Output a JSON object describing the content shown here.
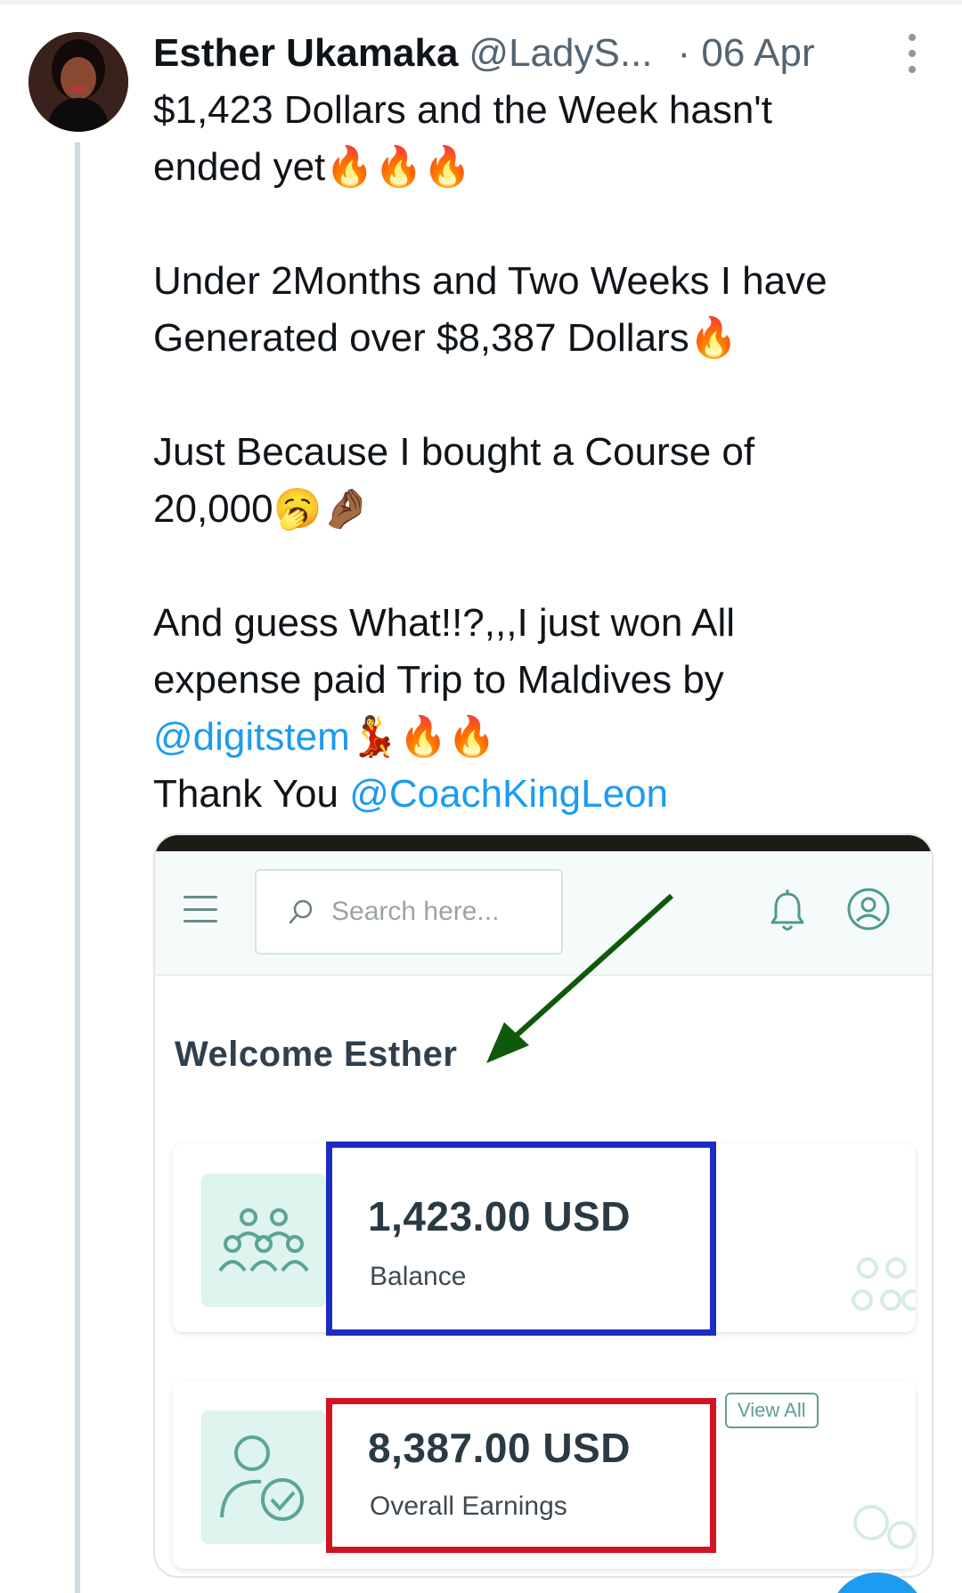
{
  "tweet": {
    "author_name": "Esther Ukamaka",
    "handle": "@LadyS...",
    "date": "· 06 Apr",
    "paragraphs": [
      {
        "lines": [
          "$1,423 Dollars and the Week hasn't",
          "ended yet🔥🔥🔥"
        ]
      },
      {
        "lines": [
          "Under 2Months and Two Weeks I have",
          "Generated over $8,387 Dollars🔥"
        ]
      },
      {
        "lines": [
          "Just Because I bought a Course of",
          "20,000🥱🤌🏾"
        ]
      }
    ],
    "last_paragraph": {
      "line1": "And guess What!!?,,,I just won All",
      "line2": "expense paid  Trip to Maldives by",
      "mention1": "@digitstem",
      "mention1_suffix": "💃🔥🔥",
      "line4_prefix": "Thank You ",
      "mention2": "@CoachKingLeon"
    }
  },
  "embedded_app": {
    "search_placeholder": "Search here...",
    "welcome": "Welcome Esther",
    "balance_amount": "1,423.00 USD",
    "balance_label": "Balance",
    "earnings_amount": "8,387.00 USD",
    "earnings_label": "Overall Earnings",
    "view_all": "View All"
  },
  "icons": {
    "more": "more-vertical-icon",
    "menu": "hamburger-menu-icon",
    "search": "search-icon",
    "bell": "notification-bell-icon",
    "user": "user-account-icon",
    "group": "users-group-icon",
    "user_check": "user-check-icon"
  },
  "colors": {
    "mention": "#1d9bf0",
    "teal_accent": "#5e9e95",
    "blue_box": "#1c2bc0",
    "red_box": "#d01422",
    "arrow": "#0f5a0a"
  }
}
